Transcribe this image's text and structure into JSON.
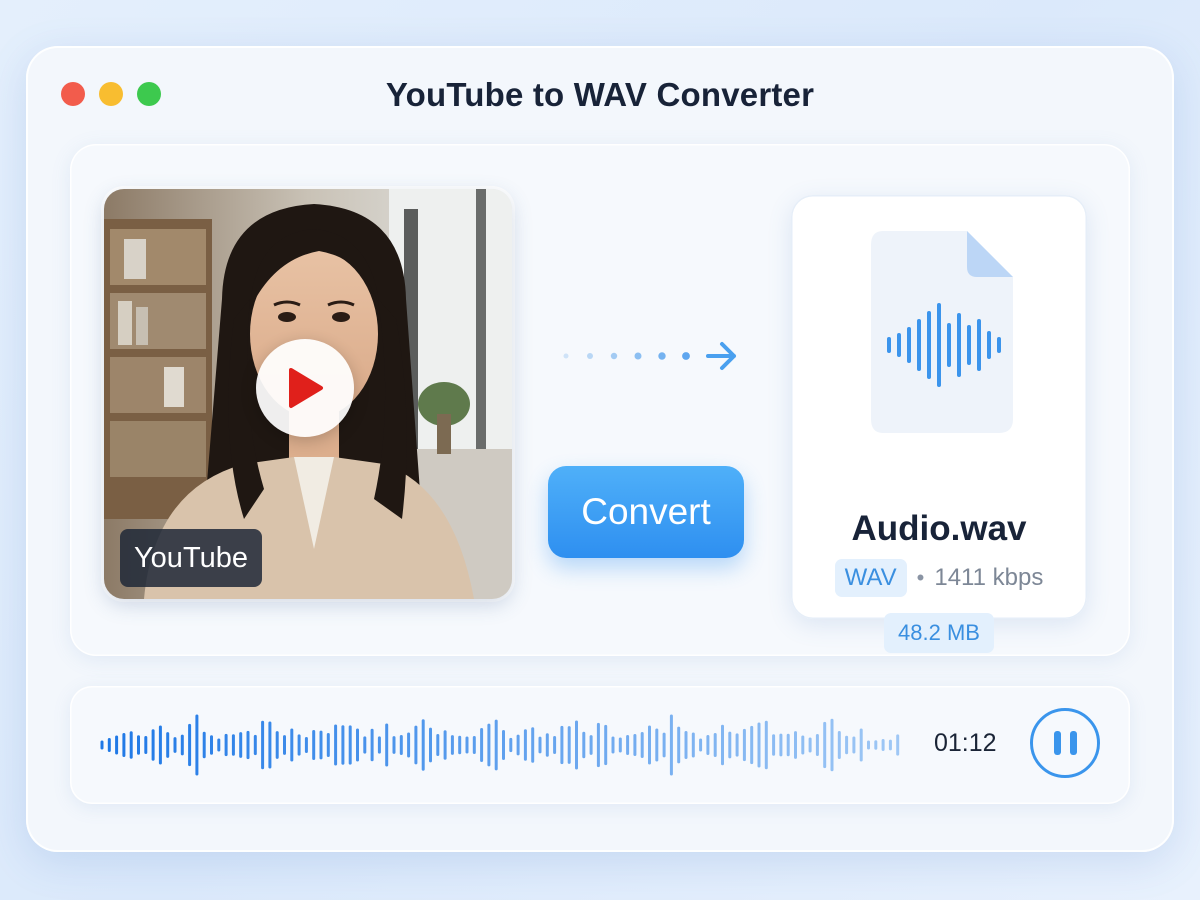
{
  "window": {
    "title": "YouTube to WAV Converter",
    "controls": [
      "close",
      "minimize",
      "maximize"
    ]
  },
  "source": {
    "platform_label": "YouTube",
    "thumbnail": "woman-in-office-video-thumbnail",
    "play_icon": "play-icon"
  },
  "action": {
    "convert_label": "Convert",
    "flow_icon": "dotted-arrow-right-icon"
  },
  "output": {
    "file_icon": "audio-file-icon",
    "file_name": "Audio.wav",
    "format_badge": "WAV",
    "separator": "•",
    "bitrate": "1411 kbps",
    "file_size": "48.2 MB"
  },
  "player": {
    "time": "01:12",
    "state_icon": "pause-icon"
  },
  "colors": {
    "accent": "#2e8ff0",
    "badge_bg": "#e3f0fd",
    "title_text": "#182338",
    "play_red": "#e0201b"
  }
}
